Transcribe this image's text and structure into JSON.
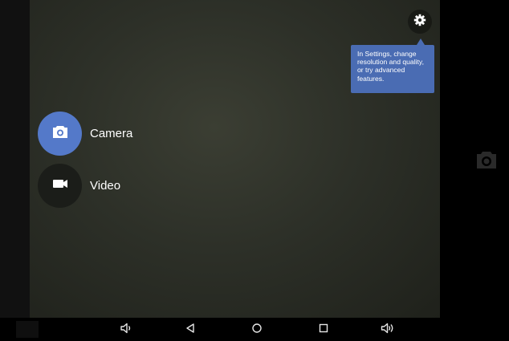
{
  "modes": [
    {
      "label": "Camera",
      "icon": "camera-icon",
      "color": "#5479c9"
    },
    {
      "label": "Video",
      "icon": "video-camera-icon"
    }
  ],
  "tooltip": {
    "text": "In Settings, change resolution and quality, or try advanced features."
  },
  "settings": {
    "icon": "gear-icon"
  },
  "shutter": {
    "icon": "camera-shutter-icon"
  },
  "navbar": {
    "buttons": [
      "volume-down-icon",
      "back-icon",
      "home-icon",
      "recents-icon",
      "volume-up-icon"
    ]
  }
}
